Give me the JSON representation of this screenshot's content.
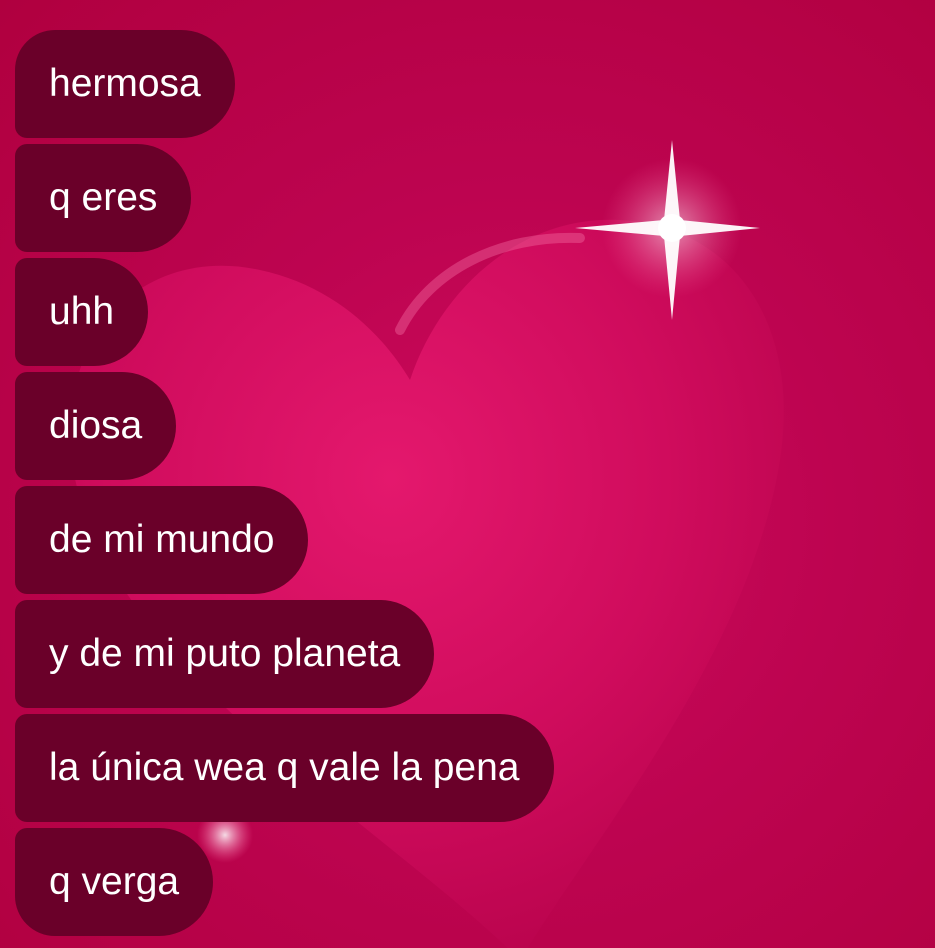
{
  "chat": {
    "background_color": "#b8004a",
    "bubble_color": "#6a0029",
    "text_color": "#ffffff",
    "decorations": [
      "heart-background",
      "sparkle-icon"
    ],
    "messages": [
      {
        "text": "hermosa"
      },
      {
        "text": "q eres"
      },
      {
        "text": "uhh"
      },
      {
        "text": "diosa"
      },
      {
        "text": "de mi mundo"
      },
      {
        "text": "y de mi puto planeta"
      },
      {
        "text": "la única wea q vale la pena"
      },
      {
        "text": "q verga"
      }
    ]
  }
}
